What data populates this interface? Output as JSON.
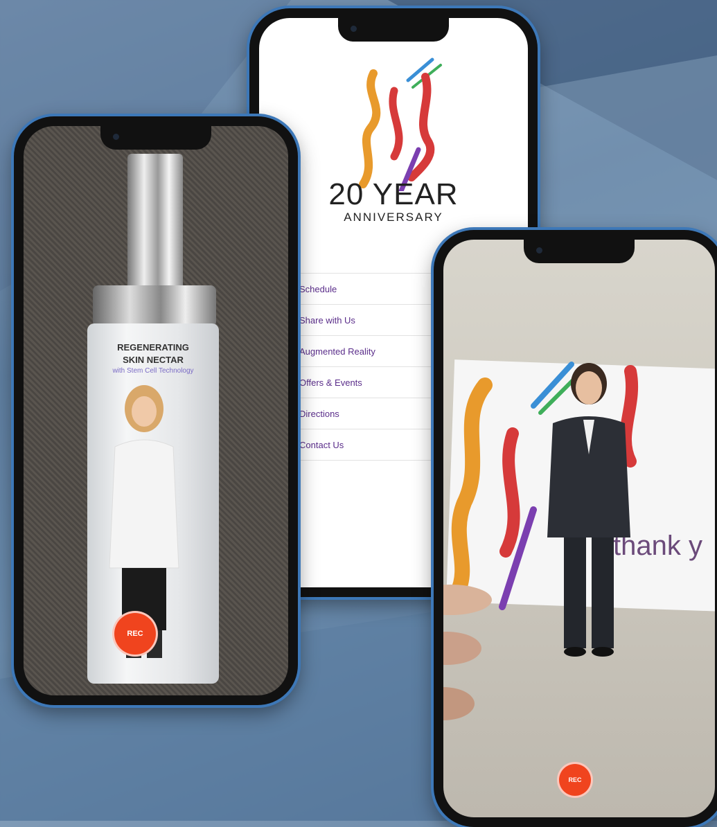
{
  "colors": {
    "background": "#6b8cad",
    "phone_frame": "#3d78b8",
    "rec_button": "#f0441e",
    "menu_text": "#5a2d8a",
    "logo_orange": "#e89a2c",
    "logo_red": "#d63a3a",
    "logo_blue": "#3a8fd6",
    "logo_green": "#3fae5a",
    "logo_purple": "#7b3fb0"
  },
  "left_phone": {
    "label_line1": "REGENERATING",
    "label_line2": "SKIN NECTAR",
    "label_line3": "with Stem Cell Technology",
    "rec_label": "REC"
  },
  "middle_phone": {
    "logo_title": "20 YEAR",
    "logo_subtitle": "ANNIVERSARY",
    "menu": [
      {
        "label": "Schedule",
        "icon": "calendar-icon"
      },
      {
        "label": "Share with Us",
        "icon": "share-icon"
      },
      {
        "label": "Augmented Reality",
        "icon": "ar-icon"
      },
      {
        "label": "Offers & Events",
        "icon": "gift-icon"
      },
      {
        "label": "Directions",
        "icon": "location-pin-icon"
      },
      {
        "label": "Contact Us",
        "icon": "mail-icon"
      }
    ]
  },
  "right_phone": {
    "card_text": "thank y",
    "rec_label": "REC"
  }
}
